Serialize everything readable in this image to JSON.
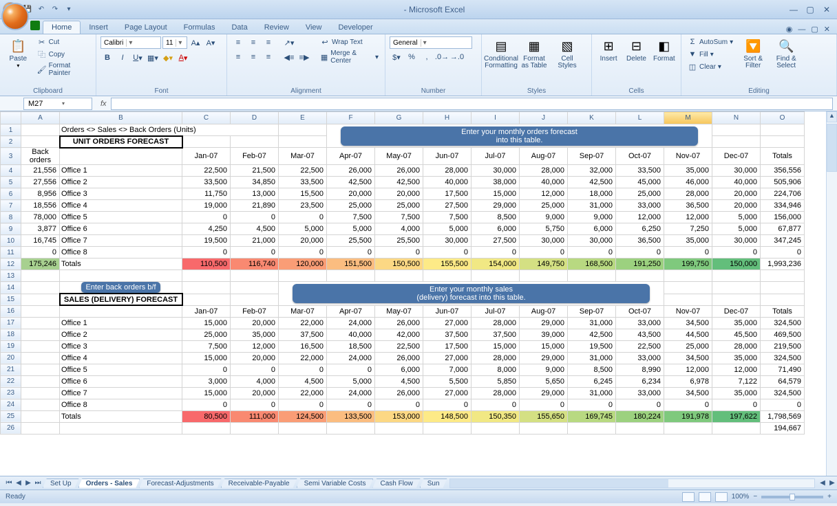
{
  "app": {
    "titleSuffix": "- Microsoft Excel"
  },
  "tabs": [
    "Home",
    "Insert",
    "Page Layout",
    "Formulas",
    "Data",
    "Review",
    "View",
    "Developer"
  ],
  "activeTab": "Home",
  "ribbon": {
    "clipboard": {
      "paste": "Paste",
      "cut": "Cut",
      "copy": "Copy",
      "fp": "Format Painter",
      "group": "Clipboard"
    },
    "font": {
      "name": "Calibri",
      "size": "11",
      "group": "Font"
    },
    "align": {
      "wrap": "Wrap Text",
      "merge": "Merge & Center",
      "group": "Alignment"
    },
    "number": {
      "format": "General",
      "group": "Number"
    },
    "styles": {
      "cond": "Conditional\nFormatting",
      "ftable": "Format\nas Table",
      "cell": "Cell\nStyles",
      "group": "Styles"
    },
    "cells": {
      "ins": "Insert",
      "del": "Delete",
      "fmt": "Format",
      "group": "Cells"
    },
    "editing": {
      "sum": "AutoSum",
      "fill": "Fill",
      "clear": "Clear",
      "sort": "Sort &\nFilter",
      "find": "Find &\nSelect",
      "group": "Editing"
    }
  },
  "nameBox": "M27",
  "colHeaders": [
    "A",
    "B",
    "C",
    "D",
    "E",
    "F",
    "G",
    "H",
    "I",
    "J",
    "K",
    "L",
    "M",
    "N",
    "O"
  ],
  "rowHeaders": [
    "1",
    "2",
    "3",
    "4",
    "5",
    "6",
    "7",
    "8",
    "9",
    "10",
    "11",
    "12",
    "13",
    "14",
    "15",
    "16",
    "17",
    "18",
    "19",
    "20",
    "21",
    "22",
    "23",
    "24",
    "25",
    "26"
  ],
  "sheet": {
    "b1": "Orders <> Sales <> Back Orders (Units)",
    "titleOrders": "UNIT ORDERS FORECAST",
    "titleSales": "SALES (DELIVERY) FORECAST",
    "hintOrders": "Enter your monthly orders forecast\ninto this table.",
    "hintSales": "Enter your monthly sales\n(delivery) forecast into this table.",
    "hintBack": "Enter back orders b/f",
    "colBack": "Back\norders",
    "months": [
      "Jan-07",
      "Feb-07",
      "Mar-07",
      "Apr-07",
      "May-07",
      "Jun-07",
      "Jul-07",
      "Aug-07",
      "Sep-07",
      "Oct-07",
      "Nov-07",
      "Dec-07"
    ],
    "totalsLabel": "Totals",
    "offices": [
      "Office 1",
      "Office 2",
      "Office 3",
      "Office 4",
      "Office 5",
      "Office 6",
      "Office 7",
      "Office 8"
    ],
    "backOrders": [
      "21,556",
      "27,556",
      "8,956",
      "18,556",
      "78,000",
      "3,877",
      "16,745",
      "0"
    ],
    "backTotal": "175,246",
    "orders": [
      [
        "22,500",
        "21,500",
        "22,500",
        "26,000",
        "26,000",
        "28,000",
        "30,000",
        "28,000",
        "32,000",
        "33,500",
        "35,000",
        "30,000",
        "356,556"
      ],
      [
        "33,500",
        "34,850",
        "33,500",
        "42,500",
        "42,500",
        "40,000",
        "38,000",
        "40,000",
        "42,500",
        "45,000",
        "46,000",
        "40,000",
        "505,906"
      ],
      [
        "11,750",
        "13,000",
        "15,500",
        "20,000",
        "20,000",
        "17,500",
        "15,000",
        "12,000",
        "18,000",
        "25,000",
        "28,000",
        "20,000",
        "224,706"
      ],
      [
        "19,000",
        "21,890",
        "23,500",
        "25,000",
        "25,000",
        "27,500",
        "29,000",
        "25,000",
        "31,000",
        "33,000",
        "36,500",
        "20,000",
        "334,946"
      ],
      [
        "0",
        "0",
        "0",
        "7,500",
        "7,500",
        "7,500",
        "8,500",
        "9,000",
        "9,000",
        "12,000",
        "12,000",
        "5,000",
        "156,000"
      ],
      [
        "4,250",
        "4,500",
        "5,000",
        "5,000",
        "4,000",
        "5,000",
        "6,000",
        "5,750",
        "6,000",
        "6,250",
        "7,250",
        "5,000",
        "67,877"
      ],
      [
        "19,500",
        "21,000",
        "20,000",
        "25,500",
        "25,500",
        "30,000",
        "27,500",
        "30,000",
        "30,000",
        "36,500",
        "35,000",
        "30,000",
        "347,245"
      ],
      [
        "0",
        "0",
        "0",
        "0",
        "0",
        "0",
        "0",
        "0",
        "0",
        "0",
        "0",
        "0",
        "0"
      ]
    ],
    "ordersTotals": [
      "110,500",
      "116,740",
      "120,000",
      "151,500",
      "150,500",
      "155,500",
      "154,000",
      "149,750",
      "168,500",
      "191,250",
      "199,750",
      "150,000",
      "1,993,236"
    ],
    "sales": [
      [
        "15,000",
        "20,000",
        "22,000",
        "24,000",
        "26,000",
        "27,000",
        "28,000",
        "29,000",
        "31,000",
        "33,000",
        "34,500",
        "35,000",
        "324,500"
      ],
      [
        "25,000",
        "35,000",
        "37,500",
        "40,000",
        "42,000",
        "37,500",
        "37,500",
        "39,000",
        "42,500",
        "43,500",
        "44,500",
        "45,500",
        "469,500"
      ],
      [
        "7,500",
        "12,000",
        "16,500",
        "18,500",
        "22,500",
        "17,500",
        "15,000",
        "15,000",
        "19,500",
        "22,500",
        "25,000",
        "28,000",
        "219,500"
      ],
      [
        "15,000",
        "20,000",
        "22,000",
        "24,000",
        "26,000",
        "27,000",
        "28,000",
        "29,000",
        "31,000",
        "33,000",
        "34,500",
        "35,000",
        "324,500"
      ],
      [
        "0",
        "0",
        "0",
        "0",
        "6,000",
        "7,000",
        "8,000",
        "9,000",
        "8,500",
        "8,990",
        "12,000",
        "12,000",
        "71,490"
      ],
      [
        "3,000",
        "4,000",
        "4,500",
        "5,000",
        "4,500",
        "5,500",
        "5,850",
        "5,650",
        "6,245",
        "6,234",
        "6,978",
        "7,122",
        "64,579"
      ],
      [
        "15,000",
        "20,000",
        "22,000",
        "24,000",
        "26,000",
        "27,000",
        "28,000",
        "29,000",
        "31,000",
        "33,000",
        "34,500",
        "35,000",
        "324,500"
      ],
      [
        "0",
        "0",
        "0",
        "0",
        "0",
        "0",
        "0",
        "0",
        "0",
        "0",
        "0",
        "0",
        "0"
      ]
    ],
    "salesTotals": [
      "80,500",
      "111,000",
      "124,500",
      "133,500",
      "153,000",
      "148,500",
      "150,350",
      "155,650",
      "169,745",
      "180,224",
      "191,978",
      "197,622",
      "1,798,569"
    ],
    "row26val": "194,667"
  },
  "sheetTabs": [
    "Set Up",
    "Orders - Sales",
    "Forecast-Adjustments",
    "Receivable-Payable",
    "Semi Variable Costs",
    "Cash Flow",
    "Sun"
  ],
  "activeSheet": "Orders - Sales",
  "status": {
    "ready": "Ready",
    "zoom": "100%"
  }
}
